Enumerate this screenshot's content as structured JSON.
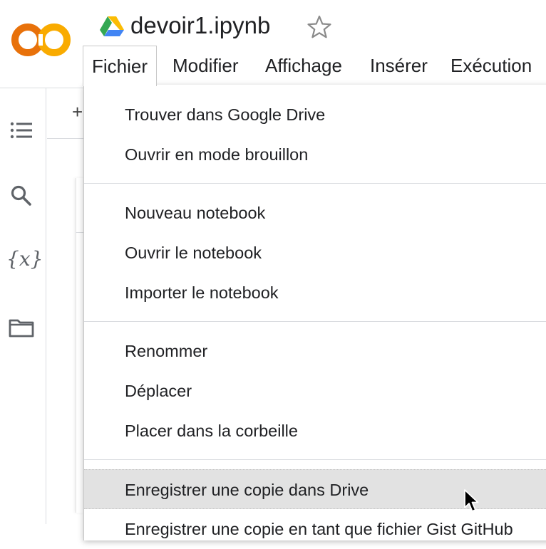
{
  "header": {
    "logo_text": "CO",
    "doc_title": "devoir1.ipynb"
  },
  "menubar": {
    "items": [
      {
        "label": "Fichier"
      },
      {
        "label": "Modifier"
      },
      {
        "label": "Affichage"
      },
      {
        "label": "Insérer"
      },
      {
        "label": "Exécution"
      }
    ]
  },
  "toolbar": {
    "plus_label": "+"
  },
  "sidebar": {
    "var_icon_text": "{x}"
  },
  "file_menu": {
    "items": [
      {
        "label": "Trouver dans Google Drive"
      },
      {
        "label": "Ouvrir en mode brouillon"
      },
      {
        "label": "Nouveau notebook"
      },
      {
        "label": "Ouvrir le notebook"
      },
      {
        "label": "Importer le notebook"
      },
      {
        "label": "Renommer"
      },
      {
        "label": "Déplacer"
      },
      {
        "label": "Placer dans la corbeille"
      },
      {
        "label": "Enregistrer une copie dans Drive"
      },
      {
        "label": "Enregistrer une copie en tant que fichier Gist GitHub"
      }
    ]
  },
  "colors": {
    "logo_orange": "#F9AB00",
    "logo_dark_orange": "#E8710A",
    "highlight": "#e2e2e2"
  }
}
